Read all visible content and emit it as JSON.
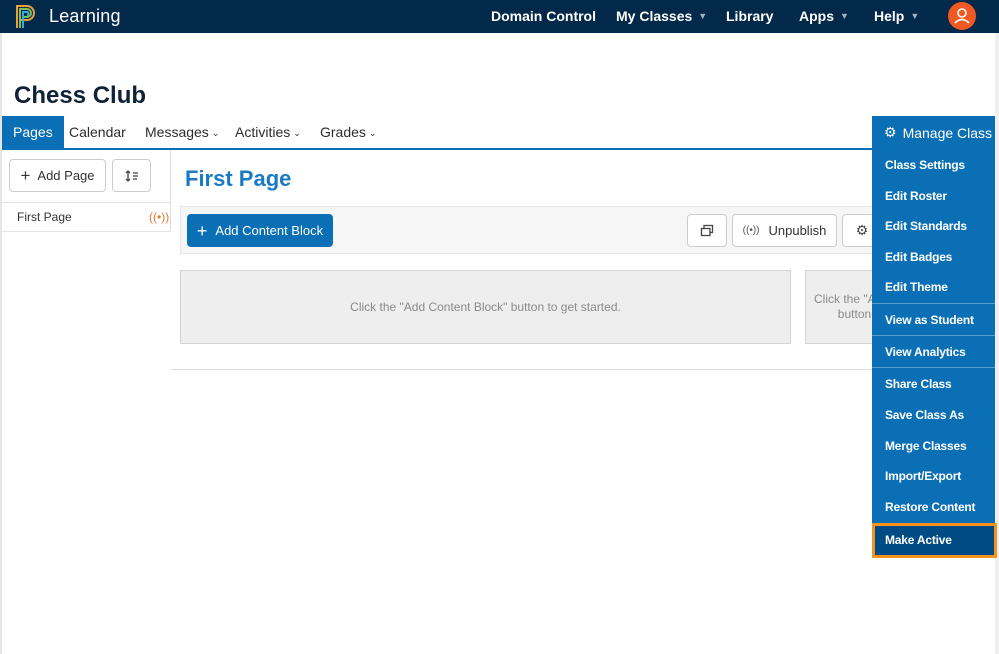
{
  "topbar": {
    "brand": "Learning",
    "nav": [
      {
        "label": "Domain Control",
        "has_chevron": false
      },
      {
        "label": "My Classes",
        "has_chevron": true
      },
      {
        "label": "Library",
        "has_chevron": false
      },
      {
        "label": "Apps",
        "has_chevron": true
      },
      {
        "label": "Help",
        "has_chevron": true
      }
    ],
    "logo_icon": "p-logo-icon",
    "avatar_icon": "user-icon"
  },
  "class_title": "Chess Club",
  "tabs": [
    {
      "label": "Pages",
      "active": true
    },
    {
      "label": "Calendar",
      "active": false
    },
    {
      "label": "Messages",
      "active": false
    },
    {
      "label": "Activities",
      "active": false
    },
    {
      "label": "Grades",
      "active": false
    }
  ],
  "sidebar": {
    "add_page_label": "Add Page",
    "pages": [
      {
        "label": "First Page",
        "status_icon": "broadcast-icon"
      }
    ]
  },
  "main": {
    "page_title": "First Page",
    "add_content_block_label": "Add Content Block",
    "unpublish_label": "Unpublish",
    "placeholder_text": "Click the \"Add Content Block\" button to get started.",
    "placeholder_text_partial_1": "Click the \"Ac",
    "placeholder_text_partial_2": "button t"
  },
  "manage_class": {
    "label": "Manage Class",
    "items": [
      "Class Settings",
      "Edit Roster",
      "Edit Standards",
      "Edit Badges",
      "Edit Theme",
      "View as Student",
      "View Analytics",
      "Share Class",
      "Save Class As",
      "Merge Classes",
      "Import/Export",
      "Restore Content",
      "Make Active"
    ],
    "highlighted_item": "Make Active"
  },
  "colors": {
    "topbar": "#03294a",
    "accent": "#0b6fb5",
    "avatar": "#f05a22",
    "highlight_border": "#f5921e"
  }
}
